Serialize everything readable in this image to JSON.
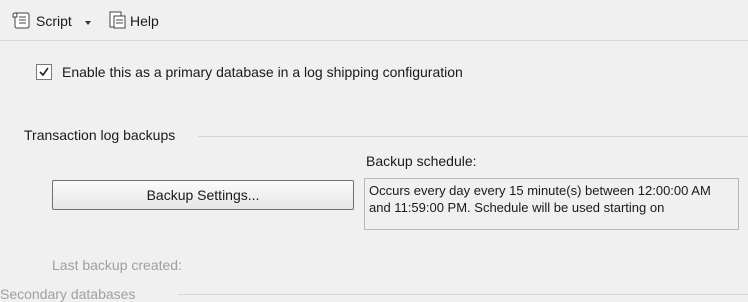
{
  "toolbar": {
    "script_label": "Script",
    "help_label": "Help"
  },
  "log_shipping": {
    "enable_label": "Enable this as a primary database in a log shipping configuration",
    "enable_checked": true
  },
  "transaction_log_backups": {
    "group_title": "Transaction log backups",
    "schedule_label": "Backup schedule:",
    "backup_settings_button": "Backup Settings...",
    "schedule_text": "Occurs every day every 15 minute(s) between 12:00:00 AM and 11:59:00 PM. Schedule will be used starting on",
    "last_backup_label": "Last backup created:"
  },
  "secondary_databases": {
    "group_title": "Secondary databases"
  }
}
